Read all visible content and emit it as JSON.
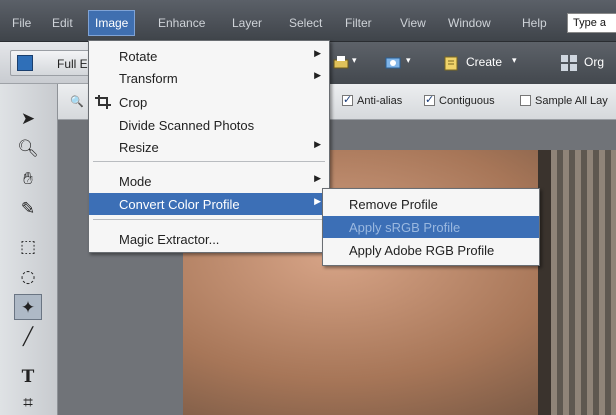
{
  "menubar": {
    "items": [
      "File",
      "Edit",
      "Image",
      "Enhance",
      "Layer",
      "Select",
      "Filter",
      "View",
      "Window",
      "Help"
    ],
    "active_index": 2,
    "search_placeholder": "Type a"
  },
  "toolbar": {
    "full_edit_label": "Full E",
    "create_label": "Create",
    "organizer_label": "Org"
  },
  "options": {
    "anti_alias": {
      "label": "Anti-alias",
      "checked": true
    },
    "contiguous": {
      "label": "Contiguous",
      "checked": true
    },
    "sample_all_layers": {
      "label": "Sample All Lay",
      "checked": false
    }
  },
  "tools": [
    "move-icon",
    "zoom-icon",
    "hand-icon",
    "eyedropper-icon",
    "marquee-icon",
    "lasso-icon",
    "magic-wand-icon",
    "brush-icon",
    "type-icon",
    "crop-icon"
  ],
  "image_menu": {
    "items": [
      {
        "label": "Rotate",
        "submenu": true
      },
      {
        "label": "Transform",
        "submenu": true
      },
      {
        "label": "Crop",
        "submenu": false,
        "icon": "crop-icon"
      },
      {
        "label": "Divide Scanned Photos",
        "submenu": false
      },
      {
        "label": "Resize",
        "submenu": true
      },
      {
        "label": "Mode",
        "submenu": true
      },
      {
        "label": "Convert Color Profile",
        "submenu": true,
        "highlighted": true
      },
      {
        "label": "Magic Extractor...",
        "submenu": false
      }
    ]
  },
  "convert_submenu": {
    "items": [
      {
        "label": "Remove Profile"
      },
      {
        "label": "Apply sRGB Profile",
        "highlighted": true
      },
      {
        "label": "Apply Adobe RGB Profile"
      }
    ]
  },
  "colors": {
    "highlight": "#3c6fb6",
    "menubar_bg": "#4c5157"
  }
}
